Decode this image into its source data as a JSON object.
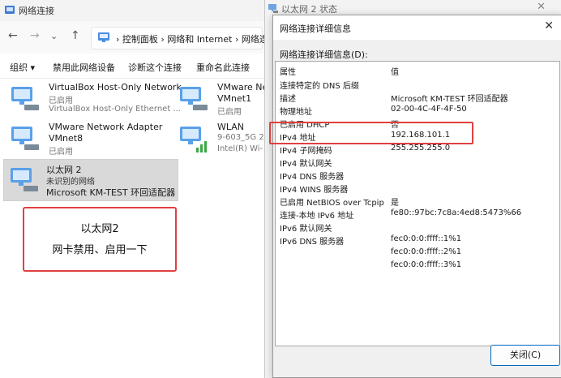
{
  "explorer": {
    "title": "网络连接",
    "address": {
      "crumbs": [
        "控制面板",
        "网络和 Internet",
        "网络连"
      ]
    },
    "commands": [
      "组织 ▾",
      "禁用此网络设备",
      "诊断这个连接",
      "重命名此连接"
    ],
    "adapters": [
      {
        "name": "VirtualBox Host-Only Network",
        "status": "已启用",
        "device": "VirtualBox Host-Only Ethernet ..."
      },
      {
        "name": "VMware Ne",
        "status": "VMnet1",
        "device": "已启用"
      },
      {
        "name": "VMware Network Adapter",
        "status": "VMnet8",
        "device": "已启用"
      },
      {
        "name": "WLAN",
        "status": "9-603_5G 2",
        "device": "Intel(R) Wi-"
      },
      {
        "name": "以太网 2",
        "status": "未识别的网络",
        "device": "Microsoft KM-TEST 环回适配器"
      }
    ]
  },
  "annotation": {
    "line1": "以太网2",
    "line2": "网卡禁用、启用一下"
  },
  "status_window": {
    "title": "以太网 2 状态",
    "close": "✕"
  },
  "dialog": {
    "title": "网络连接详细信息",
    "close": "✕",
    "label": "网络连接详细信息(D):",
    "headers": {
      "key": "属性",
      "value": "值"
    },
    "rows": [
      {
        "k": "连接特定的 DNS 后缀",
        "v": ""
      },
      {
        "k": "描述",
        "v": "Microsoft KM-TEST 环回适配器"
      },
      {
        "k": "物理地址",
        "v": "02-00-4C-4F-4F-50"
      },
      {
        "k": "已启用 DHCP",
        "v": "否"
      },
      {
        "k": "IPv4 地址",
        "v": "192.168.101.1"
      },
      {
        "k": "IPv4 子网掩码",
        "v": "255.255.255.0"
      },
      {
        "k": "IPv4 默认网关",
        "v": ""
      },
      {
        "k": "IPv4 DNS 服务器",
        "v": ""
      },
      {
        "k": "IPv4 WINS 服务器",
        "v": ""
      },
      {
        "k": "已启用 NetBIOS over Tcpip",
        "v": "是"
      },
      {
        "k": "连接-本地 IPv6 地址",
        "v": "fe80::97bc:7c8a:4ed8:5473%66"
      },
      {
        "k": "IPv6 默认网关",
        "v": ""
      },
      {
        "k": "IPv6 DNS 服务器",
        "v": "fec0:0:0:ffff::1%1"
      },
      {
        "k": "",
        "v": "fec0:0:0:ffff::2%1"
      },
      {
        "k": "",
        "v": "fec0:0:0:ffff::3%1"
      }
    ],
    "close_button": "关闭(C)"
  }
}
